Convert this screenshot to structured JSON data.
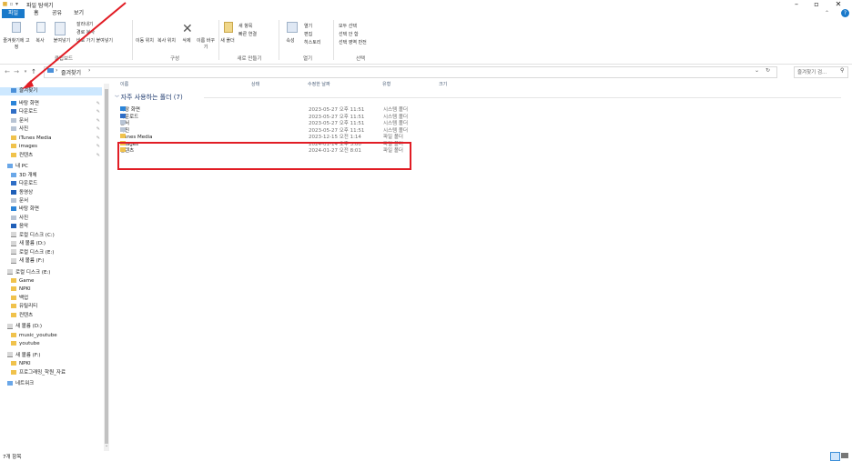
{
  "window": {
    "title": "파일 탐색기"
  },
  "tabs": [
    "파일",
    "홈",
    "공유",
    "보기"
  ],
  "ribbon": {
    "buttons": [
      "즐겨찾기에 고정",
      "복사",
      "붙여넣기",
      "잘라내기",
      "경로 복사",
      "바로 가기 붙여넣기",
      "이동 위치",
      "복사 위치",
      "삭제",
      "이름 바꾸기",
      "새 폴더",
      "새 항목",
      "빠른 연결",
      "속성",
      "열기",
      "편집",
      "히스토리",
      "모두 선택",
      "선택 안 함",
      "선택 영역 반전"
    ],
    "groups": [
      "클립보드",
      "구성",
      "새로 만들기",
      "열기",
      "선택"
    ]
  },
  "address": {
    "path": "즐겨찾기",
    "search_placeholder": "즐겨찾기 검..."
  },
  "nav": {
    "quick_access": "즐겨찾기",
    "quick_items": [
      "바탕 화면",
      "다운로드",
      "문서",
      "사진",
      "iTunes Media",
      "images",
      "컨텐츠"
    ],
    "pc": "내 PC",
    "pc_items": [
      "3D 개체",
      "다운로드",
      "동영상",
      "문서",
      "바탕 화면",
      "사진",
      "음악",
      "로컬 디스크 (C:)",
      "새 볼륨 (D:)",
      "로컬 디스크 (E:)",
      "새 볼륨 (F:)"
    ],
    "drive_e": "로컬 디스크 (E:)",
    "drive_e_items": [
      "Game",
      "NPKI",
      "백업",
      "유틸리티",
      "컨텐츠"
    ],
    "drive_d": "새 볼륨 (D:)",
    "drive_d_items": [
      "music_youtube",
      "youtube"
    ],
    "drive_f": "새 볼륨 (F:)",
    "drive_f_items": [
      "NPKI",
      "프로그래밍_학원_자료"
    ],
    "network": "네트워크"
  },
  "columns": [
    "이름",
    "상태",
    "수정한 날짜",
    "유형",
    "크기"
  ],
  "group_header": "자주 사용하는 폴더 (7)",
  "rows": [
    {
      "name": "바탕 화면",
      "date": "2023-05-27 오후 11:51",
      "type": "시스템 폴더"
    },
    {
      "name": "다운로드",
      "date": "2023-05-27 오후 11:51",
      "type": "시스템 폴더"
    },
    {
      "name": "문서",
      "date": "2023-05-27 오후 11:51",
      "type": "시스템 폴더"
    },
    {
      "name": "사진",
      "date": "2023-05-27 오후 11:51",
      "type": "시스템 폴더"
    },
    {
      "name": "iTunes Media",
      "date": "2023-12-15 오전 1:14",
      "type": "파일 폴더"
    },
    {
      "name": "images",
      "date": "2024-01-14 오후 3:00",
      "type": "파일 폴더"
    },
    {
      "name": "컨텐츠",
      "date": "2024-01-27 오전 8:01",
      "type": "파일 폴더"
    }
  ],
  "status": {
    "count": "7개 항목"
  },
  "colors": {
    "accent": "#1979ca",
    "selection": "#cde8ff",
    "annotation": "#e11d25"
  }
}
